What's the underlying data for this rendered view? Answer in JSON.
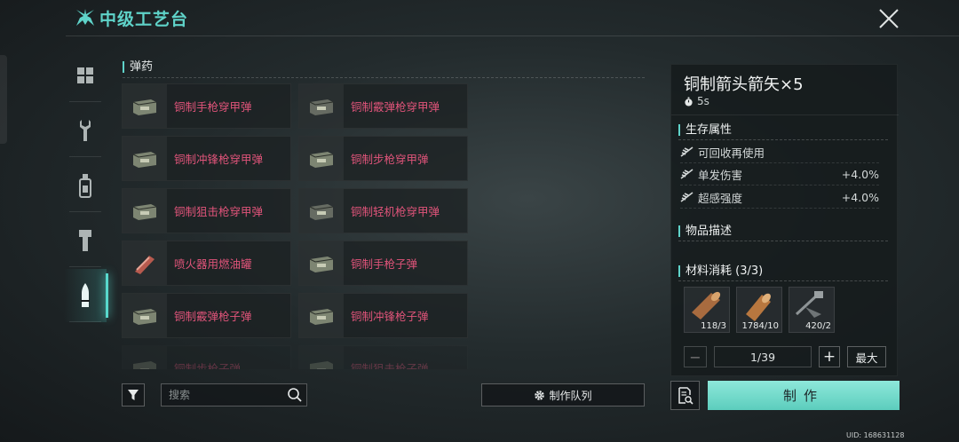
{
  "header": {
    "title": "中级工艺台"
  },
  "sidebar": {
    "items": [
      {
        "icon": "grid-icon"
      },
      {
        "icon": "wrench-icon"
      },
      {
        "icon": "bottle-icon"
      },
      {
        "icon": "torch-icon"
      },
      {
        "icon": "bullet-icon",
        "active": true
      }
    ]
  },
  "category": {
    "title": "弹药"
  },
  "recipes": [
    {
      "label": "铜制手枪穿甲弹",
      "icon": "ammo-box-icon"
    },
    {
      "label": "铜制霰弹枪穿甲弹",
      "icon": "ammo-box-icon"
    },
    {
      "label": "铜制冲锋枪穿甲弹",
      "icon": "ammo-box-icon"
    },
    {
      "label": "铜制步枪穿甲弹",
      "icon": "ammo-box-icon"
    },
    {
      "label": "铜制狙击枪穿甲弹",
      "icon": "ammo-box-icon"
    },
    {
      "label": "铜制轻机枪穿甲弹",
      "icon": "ammo-box-icon"
    },
    {
      "label": "喷火器用燃油罐",
      "icon": "fuel-canister-icon"
    },
    {
      "label": "铜制手枪子弹",
      "icon": "ammo-box-icon"
    },
    {
      "label": "铜制霰弹枪子弹",
      "icon": "ammo-box-icon"
    },
    {
      "label": "铜制冲锋枪子弹",
      "icon": "ammo-box-icon"
    },
    {
      "label": "铜制步枪子弹",
      "icon": "ammo-box-icon"
    },
    {
      "label": "铜制狙击枪子弹",
      "icon": "ammo-box-icon"
    }
  ],
  "search": {
    "placeholder": "搜索",
    "value": ""
  },
  "queue_button": {
    "label": "制作队列"
  },
  "detail": {
    "name": "铜制箭头箭矢×5",
    "time": "5s",
    "survival_title": "生存属性",
    "stats": [
      {
        "label": "可回收再使用",
        "value": ""
      },
      {
        "label": "单发伤害",
        "value": "+4.0%"
      },
      {
        "label": "超感强度",
        "value": "+4.0%"
      }
    ],
    "description_title": "物品描述",
    "materials_title": "材料消耗 (3/3)",
    "materials": [
      {
        "icon": "wood-log-icon",
        "count": "118/3"
      },
      {
        "icon": "wood-log-icon",
        "count": "1784/10"
      },
      {
        "icon": "scrap-metal-icon",
        "count": "420/2"
      }
    ],
    "quantity": "1/39",
    "max_label": "最大",
    "craft_label": "制作"
  },
  "footer": {
    "uid": "UID: 168631128"
  },
  "colors": {
    "accent": "#5fd3c9",
    "recipe_text": "#e0547a",
    "craft_button": "#7adbd0"
  }
}
